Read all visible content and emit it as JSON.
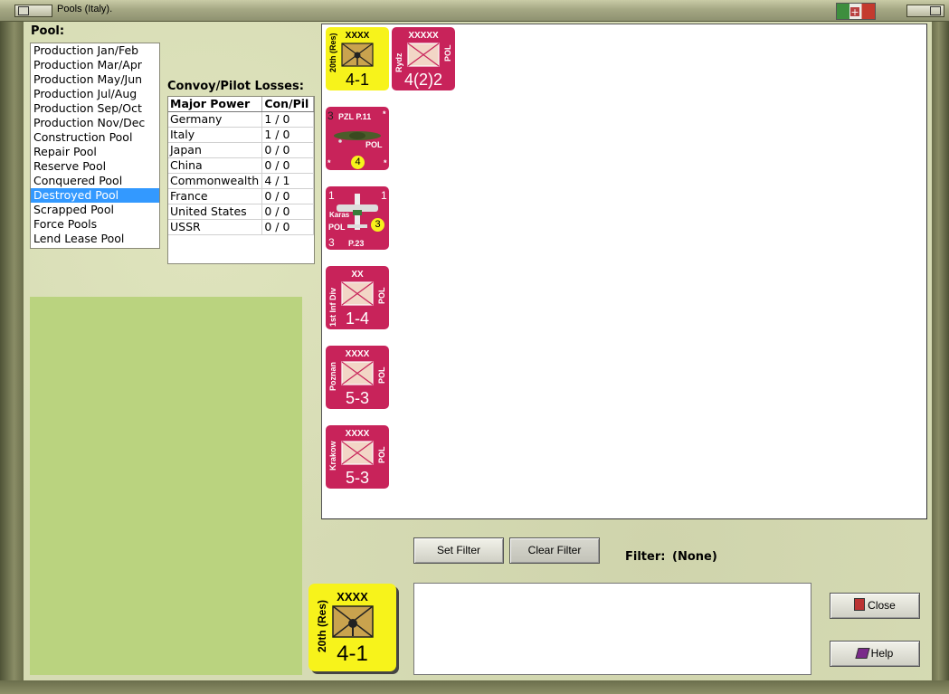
{
  "window": {
    "title": "Pools (Italy)."
  },
  "pool": {
    "heading": "Pool:",
    "items": [
      "Production Jan/Feb",
      "Production Mar/Apr",
      "Production May/Jun",
      "Production Jul/Aug",
      "Production Sep/Oct",
      "Production Nov/Dec",
      "Construction Pool",
      "Repair Pool",
      "Reserve Pool",
      "Conquered Pool",
      "Destroyed Pool",
      "Scrapped Pool",
      "Force Pools",
      "Lend Lease Pool"
    ],
    "selected": "Destroyed Pool"
  },
  "convoy": {
    "heading": "Convoy/Pilot Losses:",
    "columns": [
      "Major Power",
      "Con/Pil"
    ],
    "rows": [
      [
        "Germany",
        "1 / 0"
      ],
      [
        "Italy",
        "1 / 0"
      ],
      [
        "Japan",
        "0 / 0"
      ],
      [
        "China",
        "0 / 0"
      ],
      [
        "Commonwealth",
        "4 / 1"
      ],
      [
        "France",
        "0 / 0"
      ],
      [
        "United States",
        "0 / 0"
      ],
      [
        "USSR",
        "0 / 0"
      ]
    ]
  },
  "units": [
    {
      "kind": "army",
      "color": "#f7f31b",
      "size": "XXXX",
      "name": "20th (Res)",
      "nation": "",
      "strength": "4-1"
    },
    {
      "kind": "hq",
      "color": "#c8235a",
      "size": "XXXXX",
      "name": "Rydz",
      "nation": "POL",
      "strength": "4(2)2"
    },
    {
      "kind": "air",
      "color": "#c8235a",
      "name": "PZL P.11",
      "nation": "POL",
      "top_left": "3",
      "rating": "4",
      "star": "*"
    },
    {
      "kind": "air2",
      "color": "#c8235a",
      "name": "P.23",
      "sub": "Karas",
      "nation": "POL",
      "top_left": "1",
      "top_right": "1",
      "bottom_left": "3",
      "rating": "3"
    },
    {
      "kind": "div",
      "color": "#c8235a",
      "size": "XX",
      "name": "1st Inf Div",
      "nation": "POL",
      "strength": "1-4"
    },
    {
      "kind": "army",
      "color": "#c8235a",
      "size": "XXXX",
      "name": "Poznan",
      "nation": "POL",
      "strength": "5-3"
    },
    {
      "kind": "army",
      "color": "#c8235a",
      "size": "XXXX",
      "name": "Krakow",
      "nation": "POL",
      "strength": "5-3"
    }
  ],
  "selected_unit": {
    "size": "XXXX",
    "name": "20th (Res)",
    "strength": "4-1"
  },
  "buttons": {
    "set_filter": "Set Filter",
    "clear_filter": "Clear Filter",
    "close": "Close",
    "help": "Help"
  },
  "filter": {
    "label": "Filter:",
    "value": "(None)"
  }
}
